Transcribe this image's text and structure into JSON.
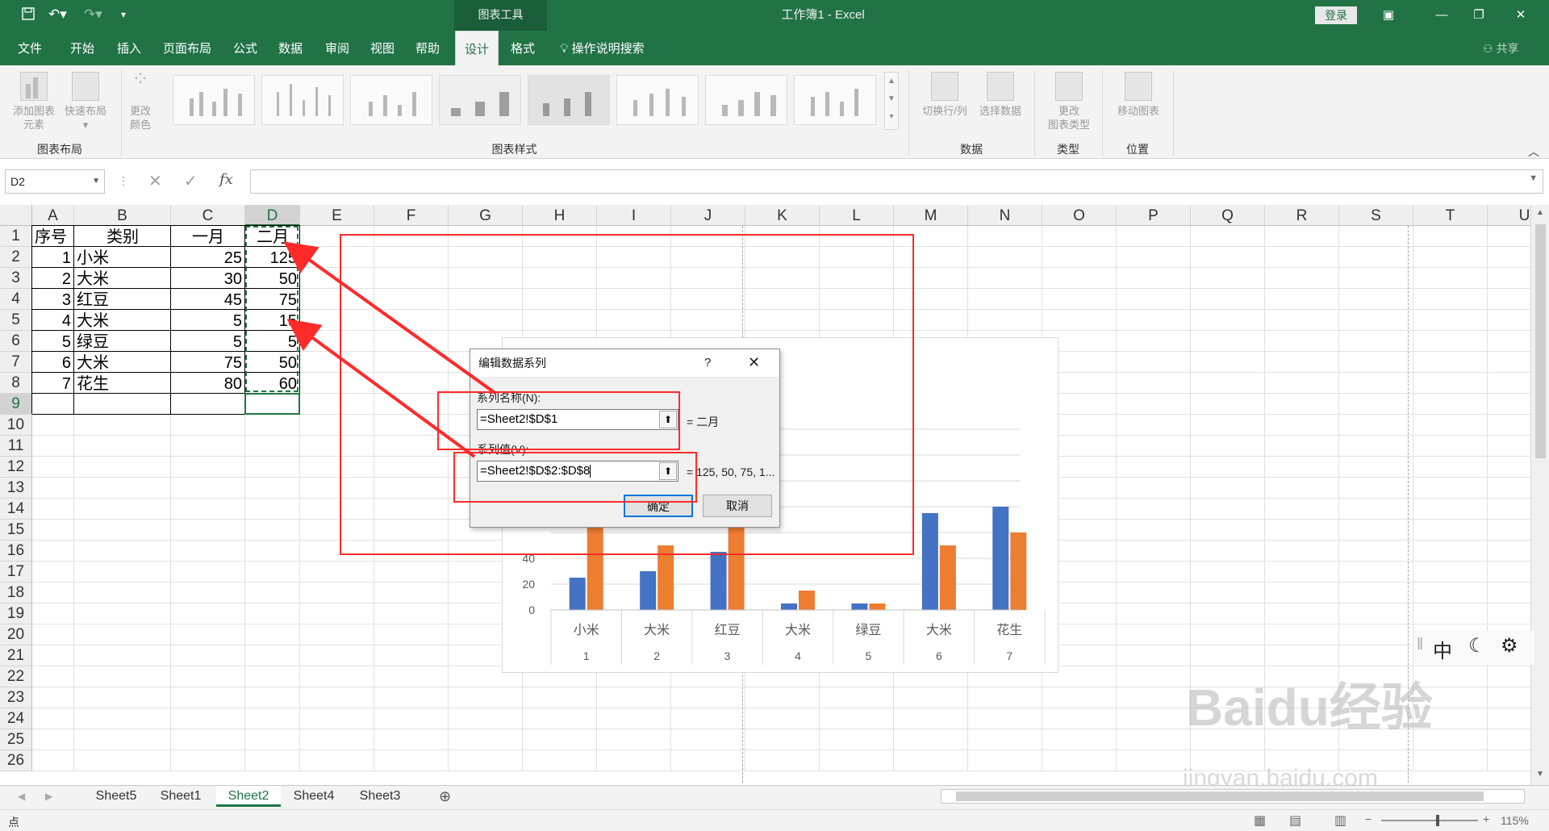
{
  "titlebar": {
    "context_tools": "图表工具",
    "window_title": "工作簿1  -  Excel",
    "login": "登录",
    "undo_icon": "undo-icon",
    "save_icon": "save-icon"
  },
  "tabs": [
    "文件",
    "开始",
    "插入",
    "页面布局",
    "公式",
    "数据",
    "审阅",
    "视图",
    "帮助",
    "设计",
    "格式"
  ],
  "active_tab": "设计",
  "tellme": "操作说明搜索",
  "share": "共享",
  "ribbon": {
    "add_element": "添加图表元素",
    "add_element_l1": "添加图表",
    "add_element_l2": "元素",
    "quick_layout": "快速布局",
    "change_colors_l1": "更改",
    "change_colors_l2": "颜色",
    "group_layout": "图表布局",
    "group_styles": "图表样式",
    "switch_rowcol": "切换行/列",
    "select_data": "选择数据",
    "group_data": "数据",
    "change_type_l1": "更改",
    "change_type_l2": "图表类型",
    "group_type": "类型",
    "move_chart": "移动图表",
    "group_location": "位置"
  },
  "formula_bar": {
    "name_box": "D2",
    "fx": "fx",
    "cancel": "✕",
    "enter": "✓"
  },
  "columns": [
    "A",
    "B",
    "C",
    "D",
    "E",
    "F",
    "G",
    "H",
    "I",
    "J",
    "K",
    "L",
    "M",
    "N",
    "O",
    "P",
    "Q",
    "R",
    "S",
    "T",
    "U"
  ],
  "rows": [
    "1",
    "2",
    "3",
    "4",
    "5",
    "6",
    "7",
    "8",
    "9",
    "10",
    "11",
    "12",
    "13",
    "14",
    "15",
    "16",
    "17",
    "18",
    "19",
    "20",
    "21",
    "22",
    "23",
    "24",
    "25",
    "26"
  ],
  "table": {
    "headers": [
      "序号",
      "类别",
      "一月",
      "二月"
    ],
    "rows": [
      [
        "1",
        "小米",
        "25",
        "125"
      ],
      [
        "2",
        "大米",
        "30",
        "50"
      ],
      [
        "3",
        "红豆",
        "45",
        "75"
      ],
      [
        "4",
        "大米",
        "5",
        "15"
      ],
      [
        "5",
        "绿豆",
        "5",
        "5"
      ],
      [
        "6",
        "大米",
        "75",
        "50"
      ],
      [
        "7",
        "花生",
        "80",
        "60"
      ]
    ]
  },
  "chart_data": {
    "type": "bar",
    "categories": [
      "小米",
      "大米",
      "红豆",
      "大米",
      "绿豆",
      "大米",
      "花生"
    ],
    "sub_categories": [
      "1",
      "2",
      "3",
      "4",
      "5",
      "6",
      "7"
    ],
    "series": [
      {
        "name": "一月",
        "values": [
          25,
          30,
          45,
          5,
          5,
          75,
          80
        ],
        "color": "#4472c4"
      },
      {
        "name": "二月",
        "values": [
          125,
          50,
          75,
          15,
          5,
          50,
          60
        ],
        "color": "#ed7d31"
      }
    ],
    "visible_ticks": [
      "0",
      "20",
      "40"
    ],
    "ylim": [
      0,
      140
    ]
  },
  "dialog": {
    "title": "编辑数据系列",
    "help": "?",
    "close": "✕",
    "name_label": "系列名称(N):",
    "name_value": "=Sheet2!$D$1",
    "name_preview": "= 二月",
    "values_label": "系列值(V):",
    "values_value": "=Sheet2!$D$2:$D$8",
    "values_preview": "= 125, 50, 75, 1...",
    "ok": "确定",
    "cancel": "取消"
  },
  "sheets": [
    "Sheet5",
    "Sheet1",
    "Sheet2",
    "Sheet4",
    "Sheet3"
  ],
  "active_sheet": "Sheet2",
  "status": {
    "mode": "点",
    "zoom": "115%"
  },
  "ime": {
    "lang": "中"
  },
  "watermark": {
    "brand": "Baidu经验",
    "url": "jingyan.baidu.com"
  },
  "colors": {
    "excel_green": "#217346",
    "annotation_red": "#ff2b2b"
  }
}
